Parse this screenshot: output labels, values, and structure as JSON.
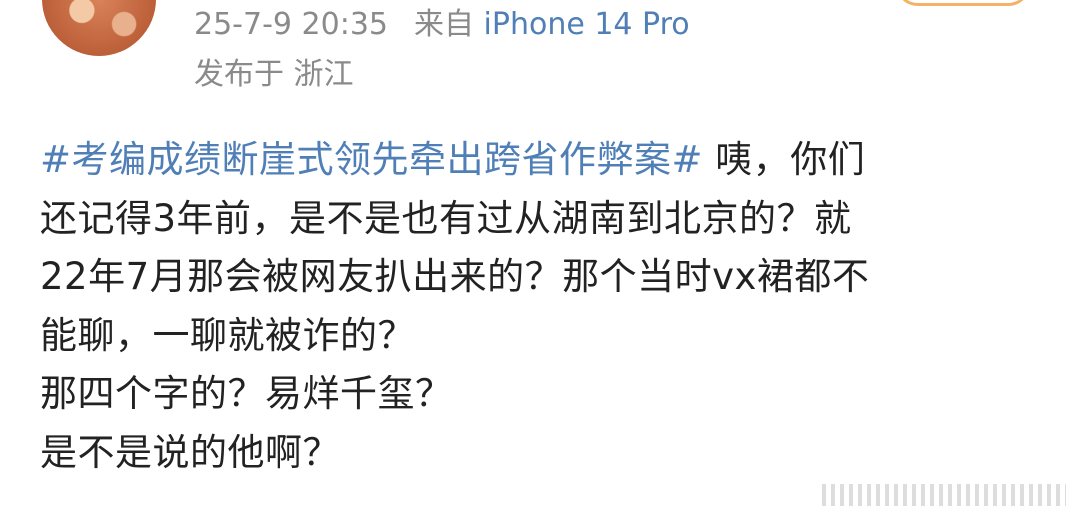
{
  "post": {
    "date": "25-7-9 20:35",
    "source_prefix": "来自",
    "device": "iPhone 14 Pro",
    "location": "发布于 浙江",
    "topic": "#考编成绩断崖式领先牵出跨省作弊案#",
    "lines": {
      "l1_rest": " 咦，你们",
      "l2": "还记得3年前，是不是也有过从湖南到北京的？就",
      "l3": "22年7月那会被网友扒出来的？那个当时vx裙都不",
      "l4": "能聊，一聊就被诈的？",
      "l5": "那四个字的？易烊千玺？",
      "l6": "是不是说的他啊？"
    }
  },
  "colors": {
    "link": "#4f7fb6",
    "meta": "#8a8a8a",
    "text": "#222222",
    "follow_border": "#f4b266"
  }
}
